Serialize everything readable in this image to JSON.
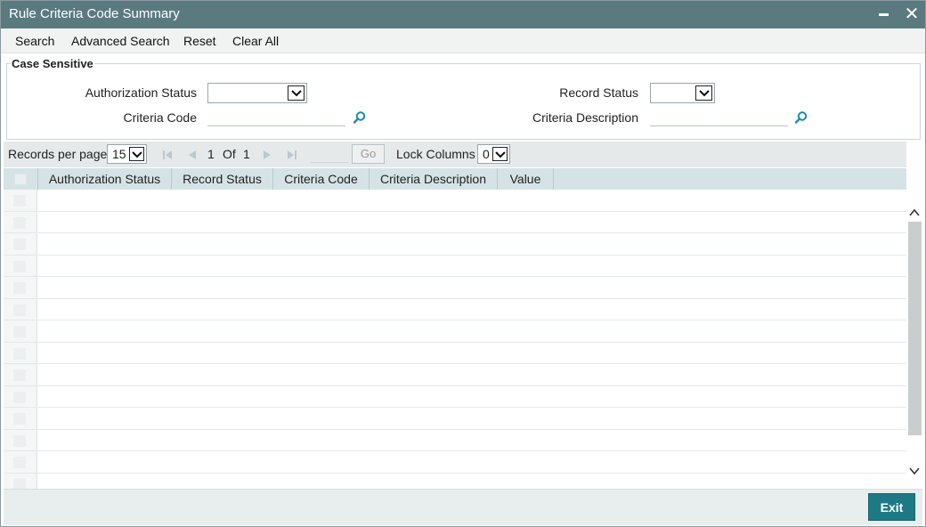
{
  "window": {
    "title": "Rule Criteria Code Summary",
    "minimize_icon": "minimize-icon",
    "close_icon": "close-icon",
    "close_glyph": "✕",
    "title_color": "#5a7a80"
  },
  "toolbar": {
    "search_label": "Search",
    "advanced_search_label": "Advanced Search",
    "reset_label": "Reset",
    "clear_all_label": "Clear All"
  },
  "criteria": {
    "legend": "Case Sensitive",
    "authorization_status_label": "Authorization Status",
    "authorization_status_value": "",
    "record_status_label": "Record Status",
    "record_status_value": "",
    "criteria_code_label": "Criteria Code",
    "criteria_code_value": "",
    "criteria_description_label": "Criteria Description",
    "criteria_description_value": "",
    "lookup_icon": "search-icon"
  },
  "pager": {
    "records_per_page_label": "Records per page",
    "records_per_page_value": "15",
    "current_page": "1",
    "of_label": "Of",
    "total_pages": "1",
    "go_label": "Go",
    "lock_columns_label": "Lock Columns",
    "lock_columns_value": "0"
  },
  "grid": {
    "columns": [
      "Authorization Status",
      "Record Status",
      "Criteria Code",
      "Criteria Description",
      "Value"
    ],
    "rows": [],
    "empty_row_count": 14
  },
  "footer": {
    "exit_label": "Exit",
    "exit_color": "#1d7a84"
  }
}
